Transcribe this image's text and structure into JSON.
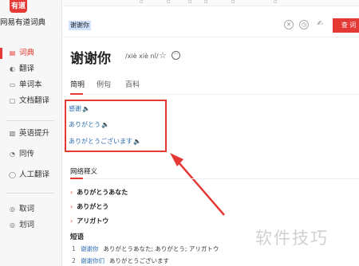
{
  "app": {
    "logo_text": "有道",
    "title": "网易有道词典"
  },
  "sidebar": {
    "items": [
      {
        "label": "词典",
        "icon": "book-icon",
        "active": true
      },
      {
        "label": "翻译",
        "icon": "translate-icon",
        "active": false
      },
      {
        "label": "单词本",
        "icon": "wordbook-icon",
        "active": false
      },
      {
        "label": "文档翻译",
        "icon": "document-icon",
        "active": false
      }
    ],
    "items2": [
      {
        "label": "英语提升",
        "icon": "grad-icon",
        "active": false
      },
      {
        "label": "同传",
        "icon": "interpret-icon",
        "active": false
      },
      {
        "label": "人工翻译",
        "icon": "person-icon",
        "active": false
      }
    ],
    "items3": [
      {
        "label": "取词",
        "icon": "capture-icon",
        "active": false
      },
      {
        "label": "划词",
        "icon": "select-icon",
        "active": false
      }
    ]
  },
  "search": {
    "value": "谢谢你",
    "query_label": "查 词"
  },
  "entry": {
    "word": "谢谢你",
    "phonetic": "/xiè xiè nǐ/"
  },
  "tabs": [
    {
      "label": "简明",
      "active": true
    },
    {
      "label": "例句",
      "active": false
    },
    {
      "label": "百科",
      "active": false
    }
  ],
  "translations": [
    {
      "text": "感谢",
      "speaker": "blue"
    },
    {
      "text": "ありがとう",
      "speaker": "red"
    },
    {
      "text": "ありがとうございます",
      "speaker": "red"
    }
  ],
  "web_defs": {
    "title": "网络释义",
    "items": [
      "ありがとうあなた",
      "ありがとう",
      "アリガトウ"
    ]
  },
  "phrases": {
    "title": "短语",
    "items": [
      {
        "num": "1",
        "term": "谢谢你",
        "meaning": "ありがとうあなた; ありがとう; アリガトウ"
      },
      {
        "num": "2",
        "term": "谢谢你们",
        "meaning": "ありがとうございます"
      }
    ]
  },
  "watermark": "软件技巧",
  "colors": {
    "accent": "#e53935",
    "link": "#2b6cb0"
  }
}
